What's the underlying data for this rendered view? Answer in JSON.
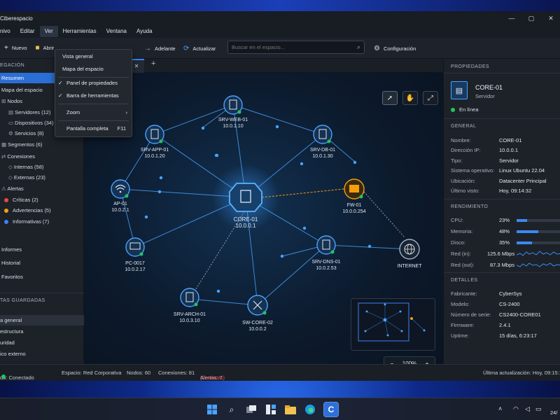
{
  "app": {
    "title": "Ciberespacio"
  },
  "menubar": [
    "nivo",
    "Editar",
    "Ver",
    "Herramientas",
    "Ventana",
    "Ayuda"
  ],
  "toolbar": {
    "new": "Nuevo",
    "open": "Abrir",
    "forward": "Adelante",
    "refresh": "Actualizar",
    "settings": "Configuración"
  },
  "search": {
    "placeholder": "Buscar en el espacio..."
  },
  "view_menu": {
    "items": [
      "Vista general",
      "Mapa del espacio",
      "Panel de propiedades",
      "Barra de herramientas",
      "Zoom",
      "Pantalla completa"
    ],
    "shortcut": "F11"
  },
  "sidebar": {
    "header": "EGACIÓN",
    "items": [
      {
        "label": "Resumen"
      },
      {
        "label": "Mapa del espacio"
      },
      {
        "label": "Nodos"
      },
      {
        "label": "Servidores (12)"
      },
      {
        "label": "Dispositivos (34)"
      },
      {
        "label": "Servicios (8)"
      },
      {
        "label": "Segmentos (6)"
      },
      {
        "label": "Conexiones"
      },
      {
        "label": "Internas (58)"
      },
      {
        "label": "Externas (23)"
      },
      {
        "label": "Alertas"
      },
      {
        "label": "Críticas (2)"
      },
      {
        "label": "Advertencias (5)"
      },
      {
        "label": "Informativas (7)"
      },
      {
        "label": "Informes"
      },
      {
        "label": "Historial"
      },
      {
        "label": "Favoritos"
      }
    ],
    "saved_header": "TAS GUARDADAS",
    "saved": [
      "a general",
      "estructura",
      "uridad",
      "ico externo"
    ]
  },
  "nodes": [
    {
      "name": "SRV-WEB-01",
      "ip": "10.0.1.10"
    },
    {
      "name": "SRV-APP-01",
      "ip": "10.0.1.20"
    },
    {
      "name": "SRV-DB-01",
      "ip": "10.0.1.30"
    },
    {
      "name": "AP-01",
      "ip": "10.0.2.1"
    },
    {
      "name": "CORE-01",
      "ip": "10.0.0.1"
    },
    {
      "name": "FW-01",
      "ip": "10.0.0.254"
    },
    {
      "name": "PC-0017",
      "ip": "10.0.2.17"
    },
    {
      "name": "SRV-DNS-01",
      "ip": "10.0.2.53"
    },
    {
      "name": "INTERNET",
      "ip": ""
    },
    {
      "name": "SRV-ARCH-01",
      "ip": "10.0.3.10"
    },
    {
      "name": "SW-CORE-02",
      "ip": "10.0.0.2"
    }
  ],
  "zoom": {
    "level": "100%",
    "minus": "−",
    "plus": "+"
  },
  "properties": {
    "header": "PROPIEDADES",
    "name": "CORE-01",
    "type": "Servidor",
    "status": "En línea",
    "general_header": "GENERAL",
    "general": [
      {
        "k": "Nombre:",
        "v": "CORE-01"
      },
      {
        "k": "Dirección IP:",
        "v": "10.0.0.1"
      },
      {
        "k": "Tipo:",
        "v": "Servidor"
      },
      {
        "k": "Sistema operativo:",
        "v": "Linux Ubuntu 22.04"
      },
      {
        "k": "Ubicación:",
        "v": "Datacenter Principal"
      },
      {
        "k": "Último visto:",
        "v": "Hoy, 09:14:32"
      }
    ],
    "perf_header": "RENDIMIENTO",
    "perf": [
      {
        "k": "CPU:",
        "v": "23%",
        "pct": 23
      },
      {
        "k": "Memoria:",
        "v": "48%",
        "pct": 48
      },
      {
        "k": "Disco:",
        "v": "35%",
        "pct": 35
      },
      {
        "k": "Red (in):",
        "v": "125.6 Mbps"
      },
      {
        "k": "Red (out):",
        "v": "87.3 Mbps"
      }
    ],
    "details_header": "DETALLES",
    "details": [
      {
        "k": "Fabricante:",
        "v": "CyberSys"
      },
      {
        "k": "Modelo:",
        "v": "CS-2400"
      },
      {
        "k": "Número de serie:",
        "v": "CS2400-CORE01"
      },
      {
        "k": "Firmware:",
        "v": "2.4.1"
      },
      {
        "k": "Uptime:",
        "v": "15 días, 6:23:17"
      }
    ]
  },
  "status": {
    "state": "do: Conectado",
    "space": "Espacio: Red Corporativa",
    "nodes": "Nodos: 60",
    "connections": "Conexiones: 81",
    "alerts": "Alertas: 7",
    "critical": "(2 críticas)",
    "updated": "Última actualización: Hoy, 09:15:10"
  },
  "taskbar": {
    "date": "24/"
  },
  "colors": {
    "accent": "#3b82f6",
    "online": "#22c55e",
    "warning": "#f59e0b",
    "critical": "#ef4444",
    "info": "#3b82f6"
  }
}
